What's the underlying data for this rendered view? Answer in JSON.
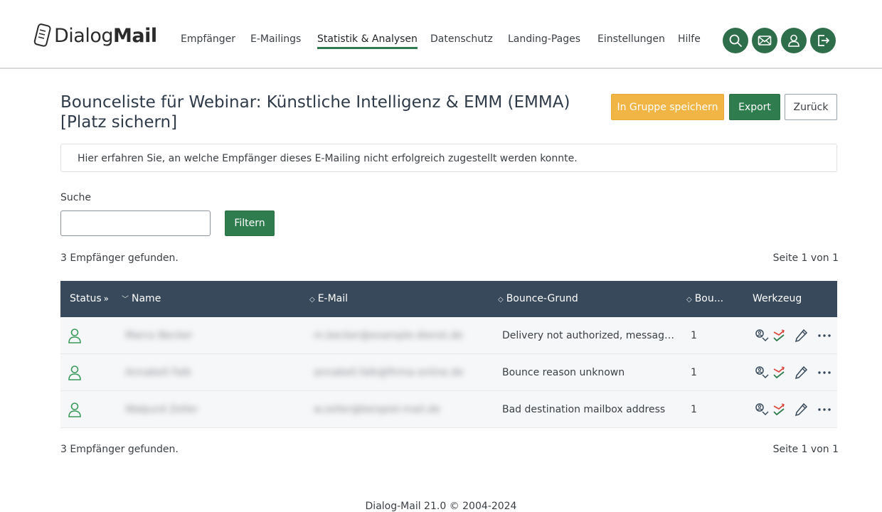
{
  "brand": {
    "prefix": "Dialog",
    "bold": "Mail"
  },
  "nav": [
    {
      "label": "Empfänger"
    },
    {
      "label": "E-Mailings"
    },
    {
      "label": "Statistik & Analysen",
      "active": true
    },
    {
      "label": "Datenschutz"
    },
    {
      "label": "Landing-Pages"
    },
    {
      "label": "Einstellungen"
    },
    {
      "label": "Hilfe"
    }
  ],
  "header_icons": [
    "search-icon",
    "mail-icon",
    "user-icon",
    "logout-icon"
  ],
  "page": {
    "title": "Bounceliste für Webinar: Künstliche Intelligenz & EMM (EMMA) [Platz sichern]",
    "buttons": {
      "save_group": "In Gruppe speichern",
      "export": "Export",
      "back": "Zurück"
    },
    "info": "Hier erfahren Sie, an welche Empfänger dieses E-Mailing nicht erfolgreich zugestellt werden konnte."
  },
  "search": {
    "label": "Suche",
    "value": "",
    "placeholder": "",
    "filter_button": "Filtern"
  },
  "results": {
    "count_text": "3 Empfänger gefunden.",
    "page_text": "Seite 1 von 1"
  },
  "table": {
    "columns": {
      "status": "Status",
      "name": "Name",
      "email": "E-Mail",
      "reason": "Bounce-Grund",
      "bounces": "Bou...",
      "tools": "Werkzeug"
    },
    "rows": [
      {
        "name": "Marco Becker",
        "email": "m.becker@example-dienst.de",
        "reason": "Delivery not authorized, message refused",
        "bounces": "1"
      },
      {
        "name": "Annabell Falk",
        "email": "annabell.falk@firma-online.de",
        "reason": "Bounce reason unknown",
        "bounces": "1"
      },
      {
        "name": "Walpurd Zeller",
        "email": "w.zeller@beispiel-mail.de",
        "reason": "Bad destination mailbox address",
        "bounces": "1"
      }
    ]
  },
  "footer": "Dialog-Mail 21.0 © 2004-2024",
  "colors": {
    "primary": "#2f7d4f",
    "accent": "#f0b544",
    "table_header": "#37495a",
    "status_green": "#3a9a5c"
  }
}
